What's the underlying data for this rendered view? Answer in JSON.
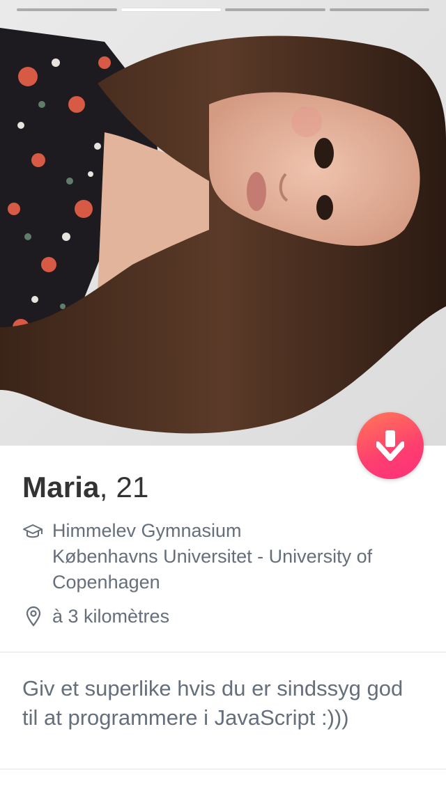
{
  "photo_progress": {
    "total": 4,
    "active_index": 1
  },
  "profile": {
    "name": "Maria",
    "age_separator": ",",
    "age": "21",
    "school": "Himmelev Gymnasium\nKøbenhavns Universitet - University of Copenhagen",
    "distance": "à 3 kilomètres",
    "bio": "Giv et superlike hvis du er sindssyg god til at programmere i JavaScript :)))"
  },
  "icons": {
    "school": "graduation-cap-icon",
    "distance": "location-pin-icon",
    "collapse": "arrow-down-icon"
  },
  "colors": {
    "accent_start": "#ff7857",
    "accent_end": "#fd2f7c",
    "name_text": "#333333",
    "secondary_text": "#656e7b",
    "divider": "#e3e3e3"
  }
}
